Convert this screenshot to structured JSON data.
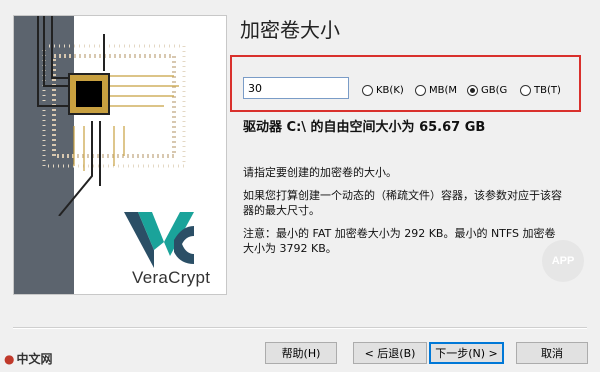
{
  "wizard": {
    "title": "加密卷大小",
    "brand": "VeraCrypt",
    "size_value": "30",
    "units": [
      {
        "label": "KB(K)",
        "checked": false
      },
      {
        "label": "MB(M",
        "checked": false
      },
      {
        "label": "GB(G",
        "checked": true
      },
      {
        "label": "TB(T)",
        "checked": false
      }
    ],
    "free_space": "驱动器 C:\\ 的自由空间大小为 65.67 GB",
    "para1": "请指定要创建的加密卷的大小。",
    "para2": "如果您打算创建一个动态的（稀疏文件）容器，该参数对应于该容器的最大尺寸。",
    "para3": "注意：最小的 FAT 加密卷大小为 292 KB。最小的 NTFS 加密卷大小为 3792 KB。"
  },
  "buttons": {
    "help": "帮助(H)",
    "back": "< 后退(B)",
    "next": "下一步(N) >",
    "cancel": "取消"
  },
  "watermarks": {
    "app": "APP",
    "site": "中文网"
  },
  "colors": {
    "highlight_border": "#d9302c",
    "brand_teal": "#1aa39a",
    "brand_dark": "#2b4f66"
  }
}
